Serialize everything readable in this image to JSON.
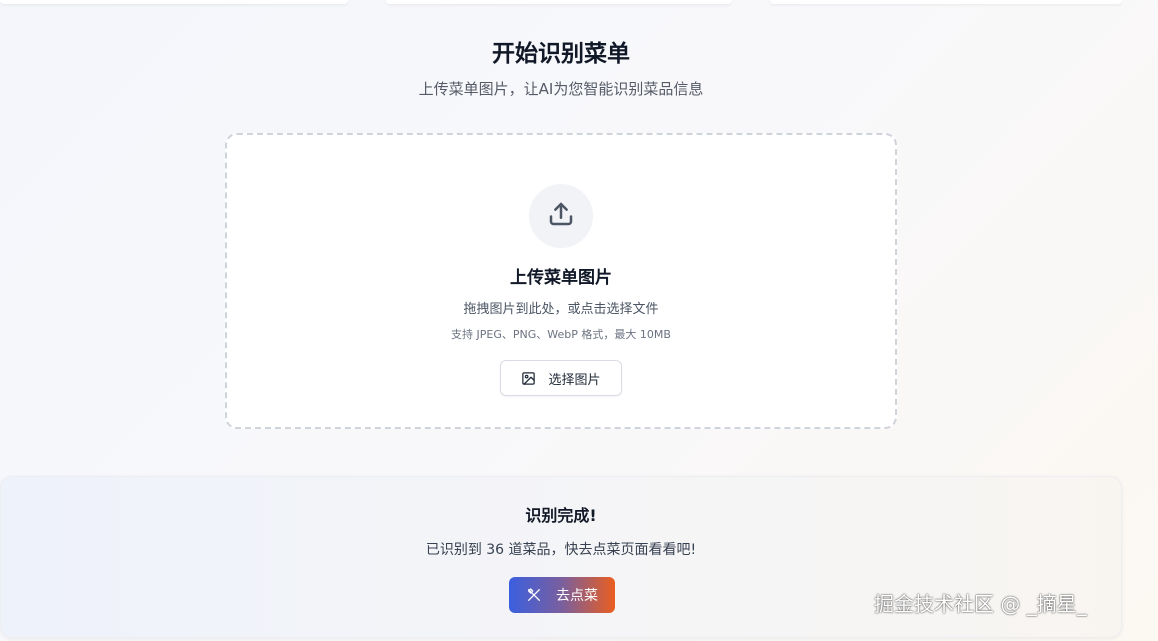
{
  "header": {
    "title": "开始识别菜单",
    "subtitle": "上传菜单图片，让AI为您智能识别菜品信息"
  },
  "upload": {
    "icon": "upload-icon",
    "title": "上传菜单图片",
    "description": "拖拽图片到此处，或点击选择文件",
    "hint": "支持 JPEG、PNG、WebP 格式，最大 10MB",
    "select_button_label": "选择图片",
    "select_button_icon": "image-icon"
  },
  "result": {
    "title": "识别完成!",
    "description": "已识别到 36 道菜品，快去点菜页面看看吧!",
    "order_button_label": "去点菜",
    "order_button_icon": "utensils-icon"
  },
  "watermark": "掘金技术社区 @ _摘星_",
  "colors": {
    "button_gradient_start": "#3b5fe0",
    "button_gradient_end": "#ea5e1f",
    "dashed_border": "#cfd3da"
  }
}
